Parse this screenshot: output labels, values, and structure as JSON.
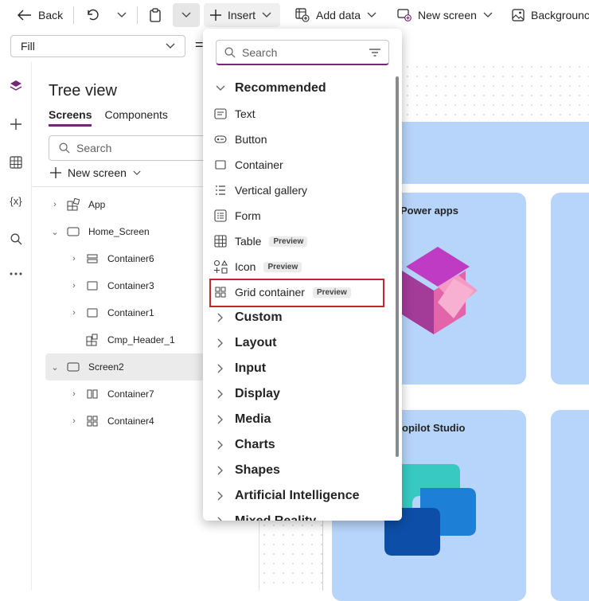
{
  "toolbar": {
    "back_label": "Back",
    "insert_label": "Insert",
    "add_data_label": "Add data",
    "new_screen_label": "New screen",
    "background_label": "Backgrounc"
  },
  "formula": {
    "property": "Fill",
    "equals": "="
  },
  "tree": {
    "title": "Tree view",
    "tabs": [
      "Screens",
      "Components"
    ],
    "search_placeholder": "Search",
    "new_screen": "New screen",
    "nodes": {
      "app": "App",
      "home_screen": "Home_Screen",
      "container6": "Container6",
      "container3": "Container3",
      "container1": "Container1",
      "cmp_header": "Cmp_Header_1",
      "screen2": "Screen2",
      "container7": "Container7",
      "container4": "Container4"
    }
  },
  "canvas": {
    "card1_title": "Power apps",
    "card2_title": "opilot Studio"
  },
  "insert_menu": {
    "search_placeholder": "Search",
    "recommended": "Recommended",
    "items": [
      "Text",
      "Button",
      "Container",
      "Vertical gallery",
      "Form",
      "Table",
      "Icon",
      "Grid container"
    ],
    "preview_badge": "Preview",
    "categories": [
      "Custom",
      "Layout",
      "Input",
      "Display",
      "Media",
      "Charts",
      "Shapes",
      "Artificial Intelligence",
      "Mixed Reality"
    ]
  },
  "colors": {
    "accent": "#742774",
    "highlight": "#c4262e",
    "card": "#b7d5fa"
  }
}
